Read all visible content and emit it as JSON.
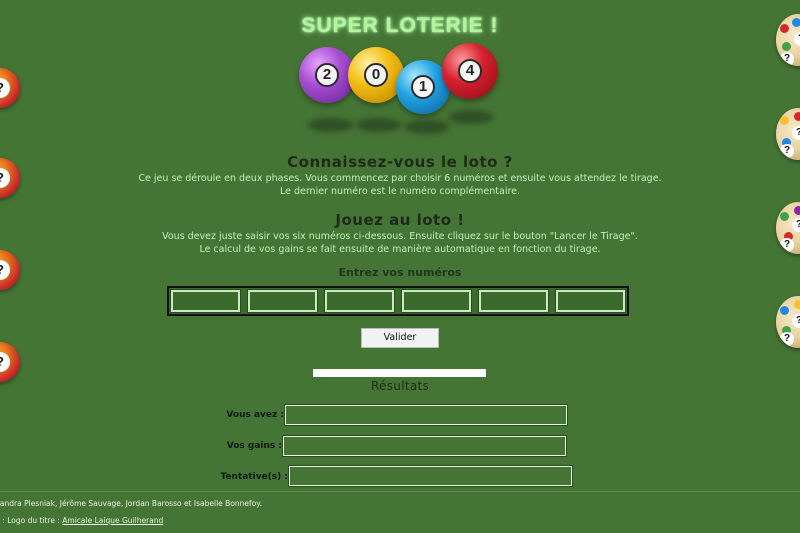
{
  "header": {
    "title": "SUPER LOTERIE !",
    "balls": [
      "2",
      "0",
      "1",
      "4"
    ]
  },
  "intro": {
    "heading": "Connaissez-vous le loto ?",
    "line1": "Ce jeu se déroule en deux phases. Vous commencez par choisir 6 numéros et ensuite vous attendez le tirage.",
    "line2": "Le dernier numéro est le numéro complémentaire."
  },
  "play": {
    "heading": "Jouez au loto !",
    "line1": "Vous devez juste saisir vos six numéros ci-dessous. Ensuite cliquez sur le bouton \"Lancer le Tirage\".",
    "line2": "Le calcul de vos gains se fait ensuite de manière automatique en fonction du tirage."
  },
  "form": {
    "enter_label": "Entrez vos numéros",
    "number_values": [
      "",
      "",
      "",
      "",
      "",
      ""
    ],
    "submit_label": "Valider"
  },
  "results": {
    "title": "Résultats",
    "rows": [
      {
        "label": "Vous avez :",
        "value": ""
      },
      {
        "label": "Vos gains :",
        "value": ""
      },
      {
        "label": "Tentative(s) :",
        "value": ""
      }
    ]
  },
  "footer": {
    "authors": "sandra Plesniak, Jérôme Sauvage, Jordan Barosso et Isabelle Bonnefoy.",
    "credit_prefix": "s : Logo du titre : ",
    "credit_link": "Amicale Laique Guilherand"
  },
  "colors": {
    "background": "#457535",
    "title_glow": "#b4f59a",
    "ball_purple": "#8e3fb8",
    "ball_yellow": "#f2b200",
    "ball_blue": "#1f9ad8",
    "ball_red": "#d21c2a"
  },
  "icons": [
    "lottery-ball-icon",
    "question-ball-icon"
  ]
}
